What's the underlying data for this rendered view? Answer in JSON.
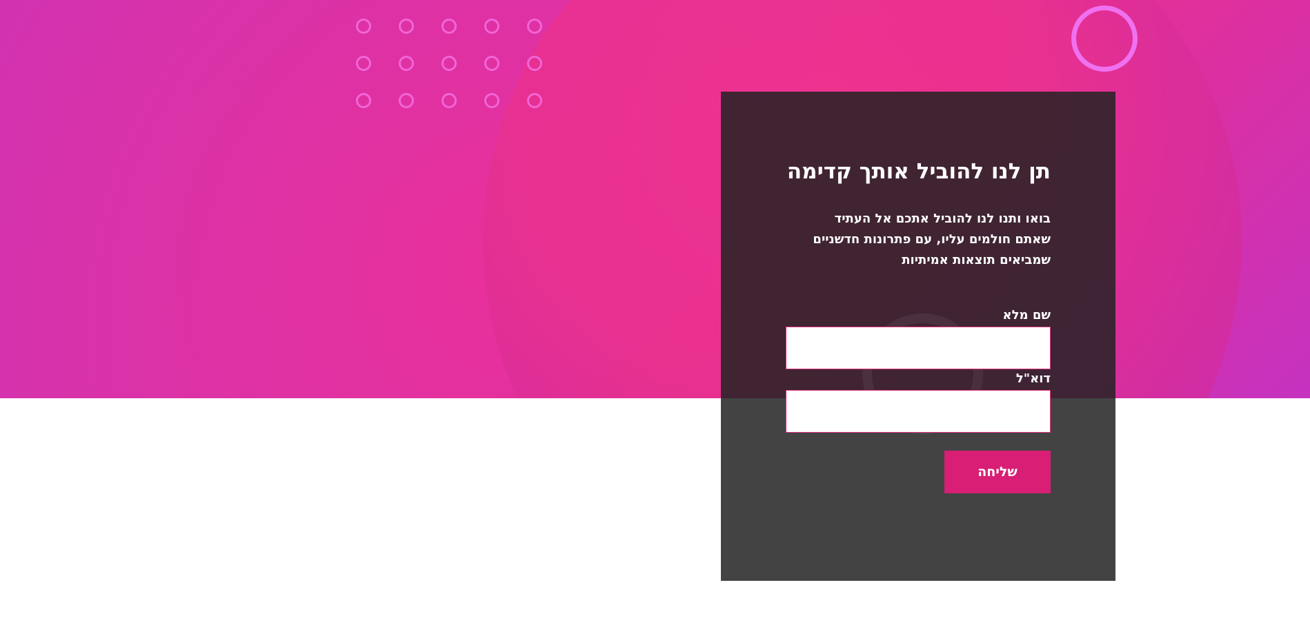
{
  "form": {
    "title": "תן לנו להוביל אותך קדימה",
    "description_lines": [
      "בואו ותנו לנו להוביל אתכם אל העתיד",
      "שאתם חולמים עליו, עם פתרונות חדשניים",
      "שמביאים תוצאות אמיתיות"
    ],
    "name_label": "שם מלא",
    "name_value": "",
    "email_label": "דוא\"ל",
    "email_value": "",
    "submit_label": "שליחה"
  },
  "colors": {
    "accent": "#d81f75",
    "panel": "#222222",
    "hero_pink": "#ea2f8f",
    "hero_purple": "#b733c8",
    "decor_ring": "#ef71f0"
  },
  "icons": [
    "decorative-circle-grid",
    "decorative-ring"
  ]
}
